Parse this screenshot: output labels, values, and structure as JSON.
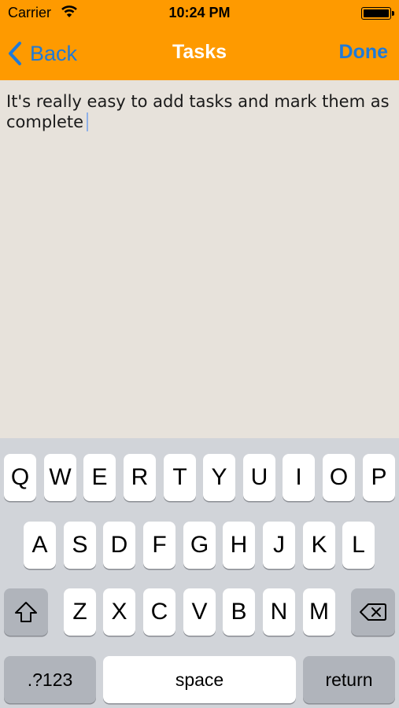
{
  "status_bar": {
    "carrier": "Carrier",
    "time": "10:24 PM"
  },
  "nav": {
    "back_label": "Back",
    "title": "Tasks",
    "done_label": "Done"
  },
  "editor": {
    "text": "It's really easy to add tasks and mark them as complete"
  },
  "keyboard": {
    "row1": [
      "Q",
      "W",
      "E",
      "R",
      "T",
      "Y",
      "U",
      "I",
      "O",
      "P"
    ],
    "row2": [
      "A",
      "S",
      "D",
      "F",
      "G",
      "H",
      "J",
      "K",
      "L"
    ],
    "row3": [
      "Z",
      "X",
      "C",
      "V",
      "B",
      "N",
      "M"
    ],
    "numbers_label": ".?123",
    "space_label": "space",
    "return_label": "return"
  },
  "colors": {
    "nav_background": "#fe9a00",
    "accent": "#1f7ad8",
    "editor_background": "#e7e2db"
  }
}
